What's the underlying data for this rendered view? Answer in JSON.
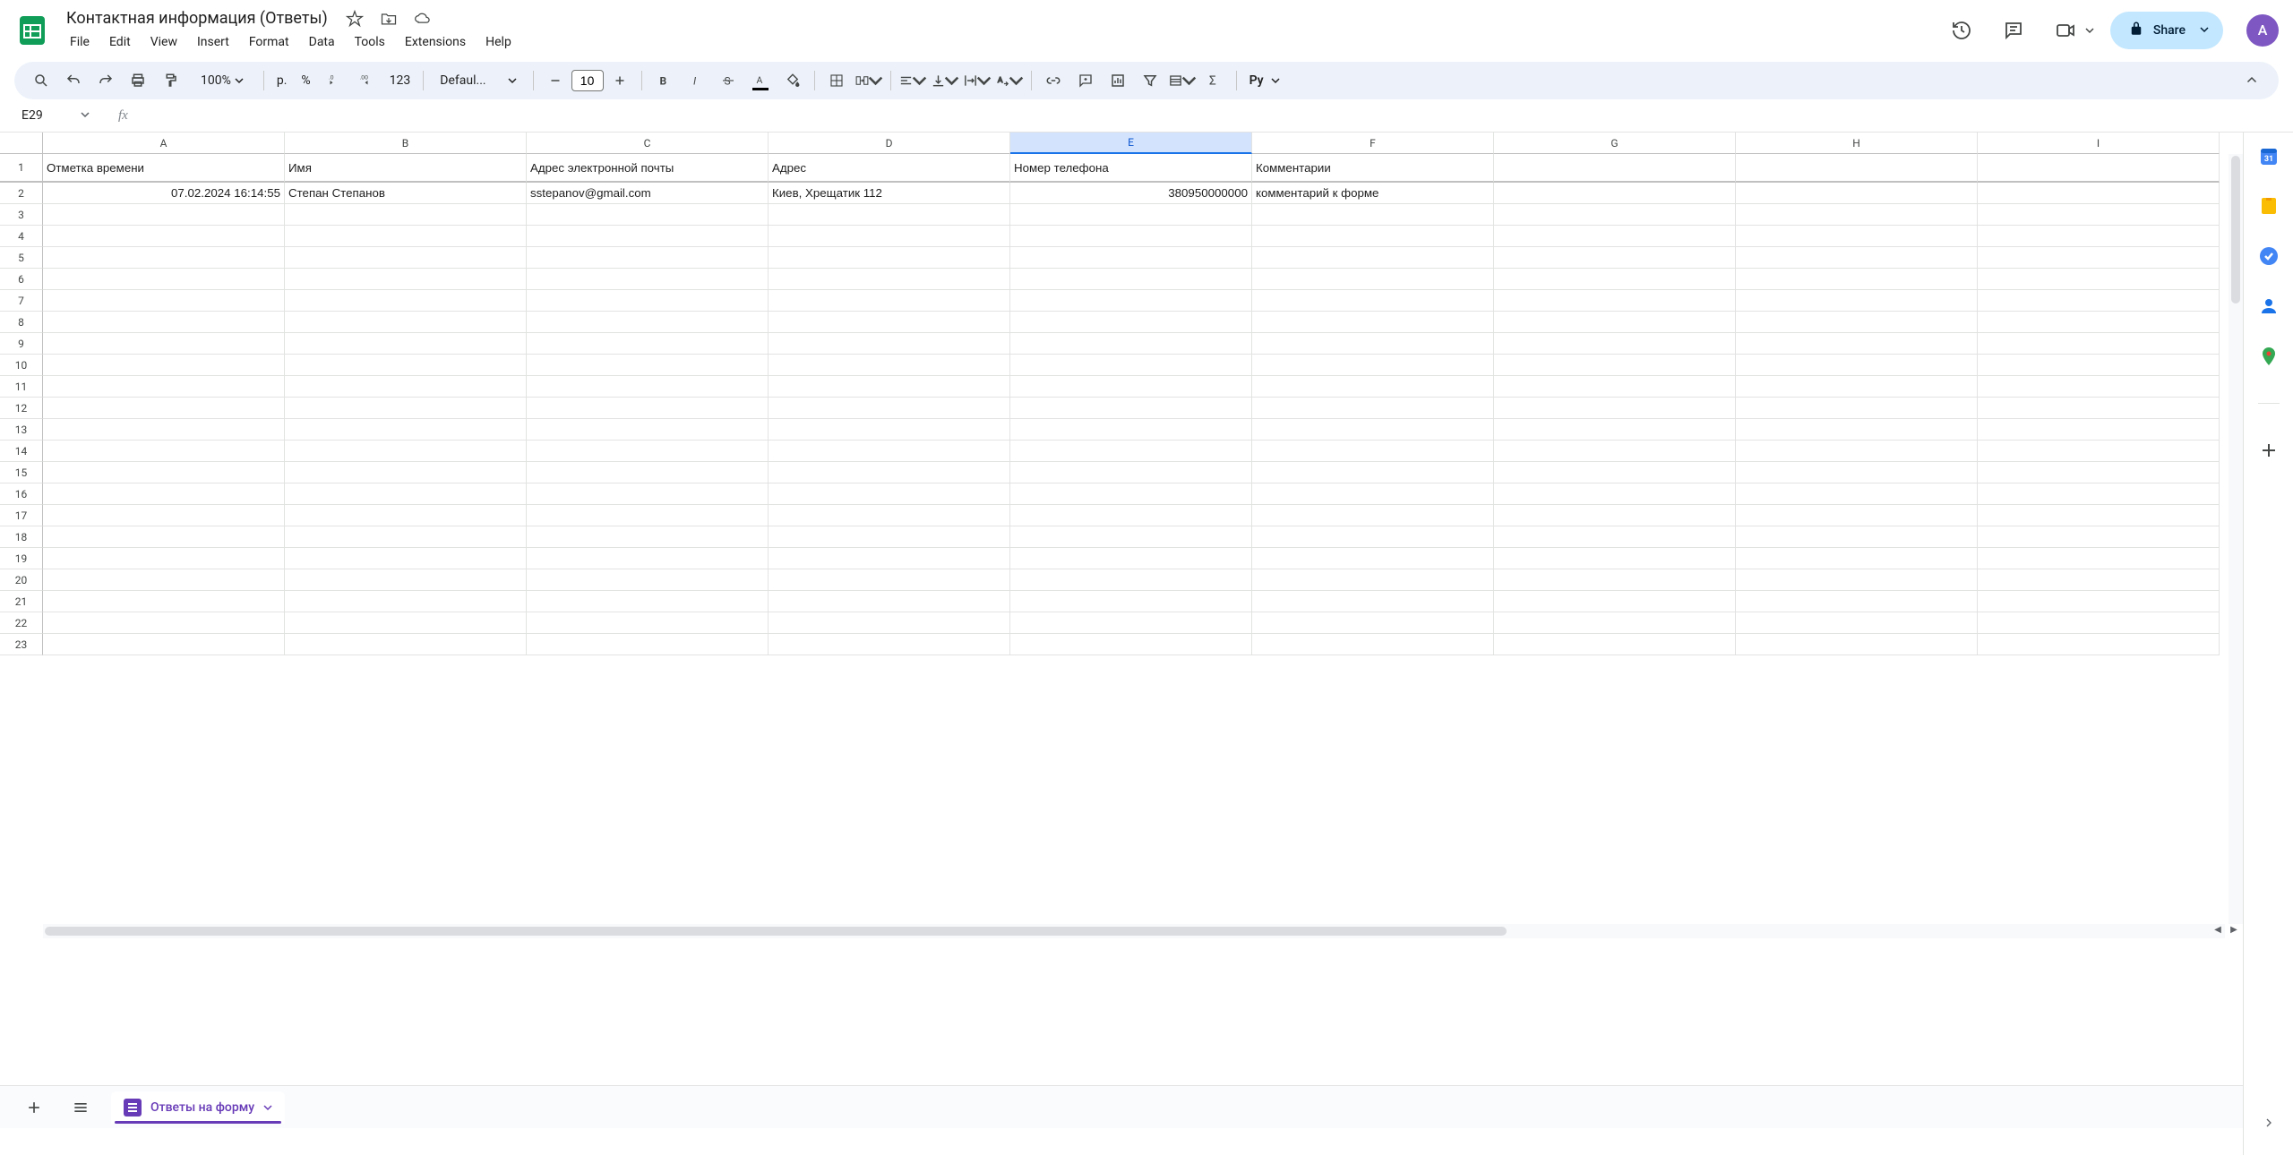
{
  "doc": {
    "title": "Контактная информация (Ответы)"
  },
  "menu": {
    "file": "File",
    "edit": "Edit",
    "view": "View",
    "insert": "Insert",
    "format": "Format",
    "data": "Data",
    "tools": "Tools",
    "extensions": "Extensions",
    "help": "Help"
  },
  "header": {
    "share": "Share",
    "avatar_initial": "A"
  },
  "toolbar": {
    "zoom": "100%",
    "currency_symbol": "р.",
    "percent": "%",
    "decimal_dec": ".0",
    "decimal_inc": ".00",
    "number_format": "123",
    "font": "Defaul...",
    "font_size": "10",
    "py_label": "Py"
  },
  "namebox": {
    "value": "E29",
    "fx": "fx"
  },
  "columns": [
    "A",
    "B",
    "C",
    "D",
    "E",
    "F",
    "G",
    "H",
    "I"
  ],
  "selected_column": "E",
  "row_count": 23,
  "headers_row": {
    "A": "Отметка времени",
    "B": "Имя",
    "C": "Адрес электронной почты",
    "D": "Адрес",
    "E": "Номер телефона",
    "F": "Комментарии"
  },
  "data_rows": [
    {
      "A": "07.02.2024 16:14:55",
      "B": "Степан Степанов",
      "C": "sstepanov@gmail.com",
      "D": "Киев, Хрещатик 112",
      "E": "380950000000",
      "F": "комментарий к форме"
    }
  ],
  "sheet_tab": {
    "label": "Ответы на форму"
  },
  "side_panel": {
    "calendar": "31"
  }
}
